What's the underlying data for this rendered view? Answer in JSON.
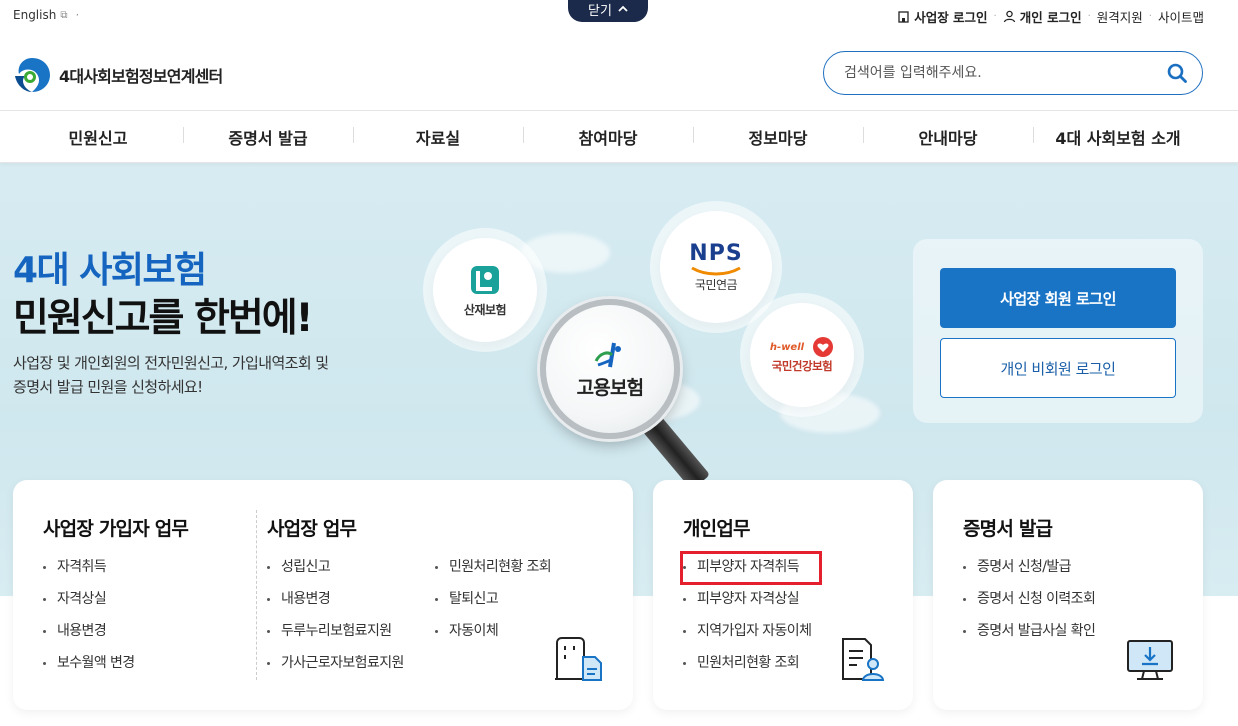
{
  "utility": {
    "lang": "English",
    "close_label": "닫기",
    "links": [
      "사업장 로그인",
      "개인 로그인",
      "원격지원",
      "사이트맵"
    ]
  },
  "header": {
    "logo_text": "4대사회보험정보연계센터",
    "search_placeholder": "검색어를 입력해주세요."
  },
  "gnb": [
    "민원신고",
    "증명서 발급",
    "자료실",
    "참여마당",
    "정보마당",
    "안내마당",
    "4대 사회보험 소개"
  ],
  "hero": {
    "title_line1": "4대 사회보험",
    "title_line2": "민원신고를 한번에!",
    "desc_line1": "사업장 및 개인회원의 전자민원신고, 가입내역조회 및",
    "desc_line2": "증명서 발급 민원을 신청하세요!",
    "circles": {
      "sanjae": "산재보험",
      "nps_logo": "NPS",
      "nps": "국민연금",
      "goyong": "고용보험",
      "hwell": "h-well",
      "health": "국민건강보험"
    },
    "login_biz": "사업장 회원 로그인",
    "login_ind": "개인 비회원 로그인"
  },
  "cards": {
    "biz_member": {
      "title": "사업장 가입자 업무",
      "items": [
        "자격취득",
        "자격상실",
        "내용변경",
        "보수월액 변경"
      ]
    },
    "biz": {
      "title": "사업장 업무",
      "col1": [
        "성립신고",
        "내용변경",
        "두루누리보험료지원",
        "가사근로자보험료지원"
      ],
      "col2": [
        "민원처리현황 조회",
        "탈퇴신고",
        "자동이체"
      ]
    },
    "personal": {
      "title": "개인업무",
      "items": [
        "피부양자 자격취득",
        "피부양자 자격상실",
        "지역가입자 자동이체",
        "민원처리현황 조회"
      ]
    },
    "cert": {
      "title": "증명서 발급",
      "items": [
        "증명서 신청/발급",
        "증명서 신청 이력조회",
        "증명서 발급사실 확인"
      ]
    }
  },
  "colors": {
    "brand": "#1a74c6",
    "navy": "#1b2a4a",
    "highlight": "#e5202e",
    "hero_bg": "#d7ecf2"
  }
}
